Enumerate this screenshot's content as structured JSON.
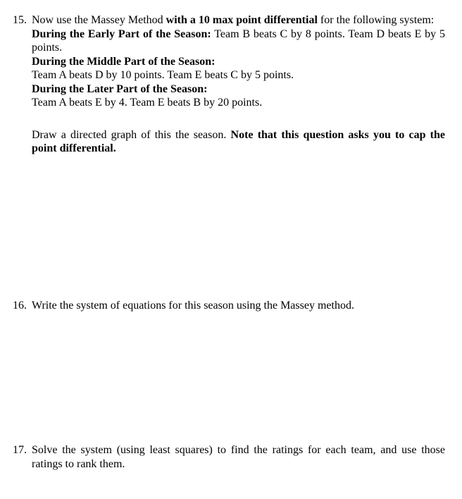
{
  "questions": [
    {
      "number": "15.",
      "intro_plain_1": "Now use the Massey Method ",
      "intro_bold": "with a 10 max point differential",
      "intro_plain_2": " for the following system:",
      "periods": [
        {
          "heading": "During the Early Part of the Season:",
          "text": " Team B beats C by 8 points. Team D beats E by 5 points."
        },
        {
          "heading": "During the Middle Part of the Season:",
          "text": "Team A beats D by 10 points. Team E beats C by 5 points."
        },
        {
          "heading": "During the Later Part of the Season:",
          "text": "Team A beats E by 4. Team E beats B by 20 points."
        }
      ],
      "instruction_plain": "Draw a directed graph of this the season. ",
      "instruction_bold": "Note that this question asks you to cap the point differential."
    },
    {
      "number": "16.",
      "text": "Write the system of equations for this season using the Massey method."
    },
    {
      "number": "17.",
      "text": "Solve the system (using least squares) to find the ratings for each team, and use those ratings to rank them."
    }
  ]
}
